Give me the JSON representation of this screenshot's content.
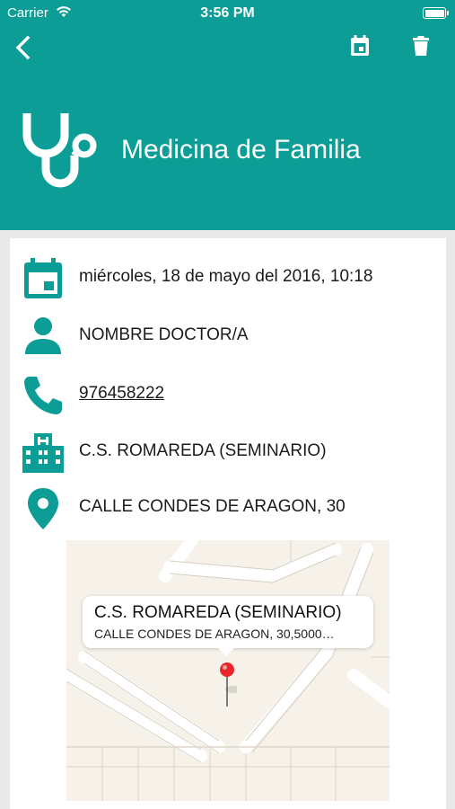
{
  "status_bar": {
    "carrier": "Carrier",
    "time": "3:56 PM"
  },
  "header": {
    "title": "Medicina de Familia",
    "background_color": "#0c9d96",
    "icons": [
      "back-icon",
      "calendar-icon",
      "trash-icon",
      "stethoscope-icon"
    ]
  },
  "details": {
    "datetime": "miércoles, 18 de mayo del 2016, 10:18",
    "doctor": "NOMBRE DOCTOR/A",
    "phone": "976458222",
    "center": "C.S. ROMAREDA (SEMINARIO)",
    "address": "CALLE CONDES DE ARAGON, 30",
    "icon_color": "#0c9d96"
  },
  "map": {
    "callout_title": "C.S. ROMAREDA (SEMINARIO)",
    "callout_subtitle": "CALLE CONDES DE ARAGON, 30,5000…",
    "pin_color": "#e8262b"
  }
}
